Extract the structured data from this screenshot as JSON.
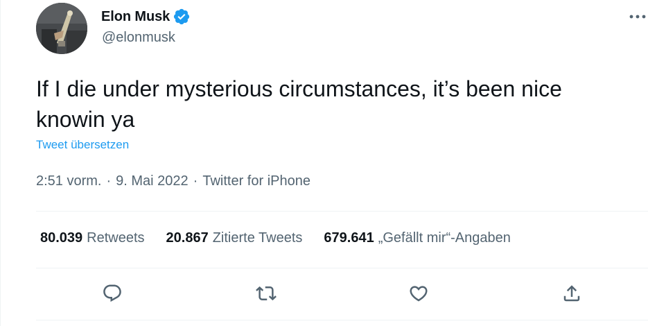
{
  "tweet": {
    "author_name": "Elon Musk",
    "author_handle": "@elonmusk",
    "verified": true,
    "text_line1": "If I die under mysterious circumstances, it’s been nice",
    "text_line2": "knowin ya",
    "translate_label": "Tweet übersetzen",
    "time": "2:51 vorm.",
    "separator": "·",
    "date": "9. Mai 2022",
    "source": "Twitter for iPhone"
  },
  "stats": [
    {
      "count": "80.039",
      "label": "Retweets"
    },
    {
      "count": "20.867",
      "label": "Zitierte Tweets"
    },
    {
      "count": "679.641",
      "label": "„Gefällt mir“-Angaben"
    }
  ],
  "icons": {
    "more": "more-horizontal-icon",
    "verified": "verified-badge-icon",
    "reply": "reply-icon",
    "retweet": "retweet-icon",
    "like": "heart-icon",
    "share": "share-icon"
  },
  "colors": {
    "accent": "#1d9bf0",
    "text_primary": "#0f1419",
    "text_secondary": "#536471",
    "divider": "#eff3f4"
  }
}
